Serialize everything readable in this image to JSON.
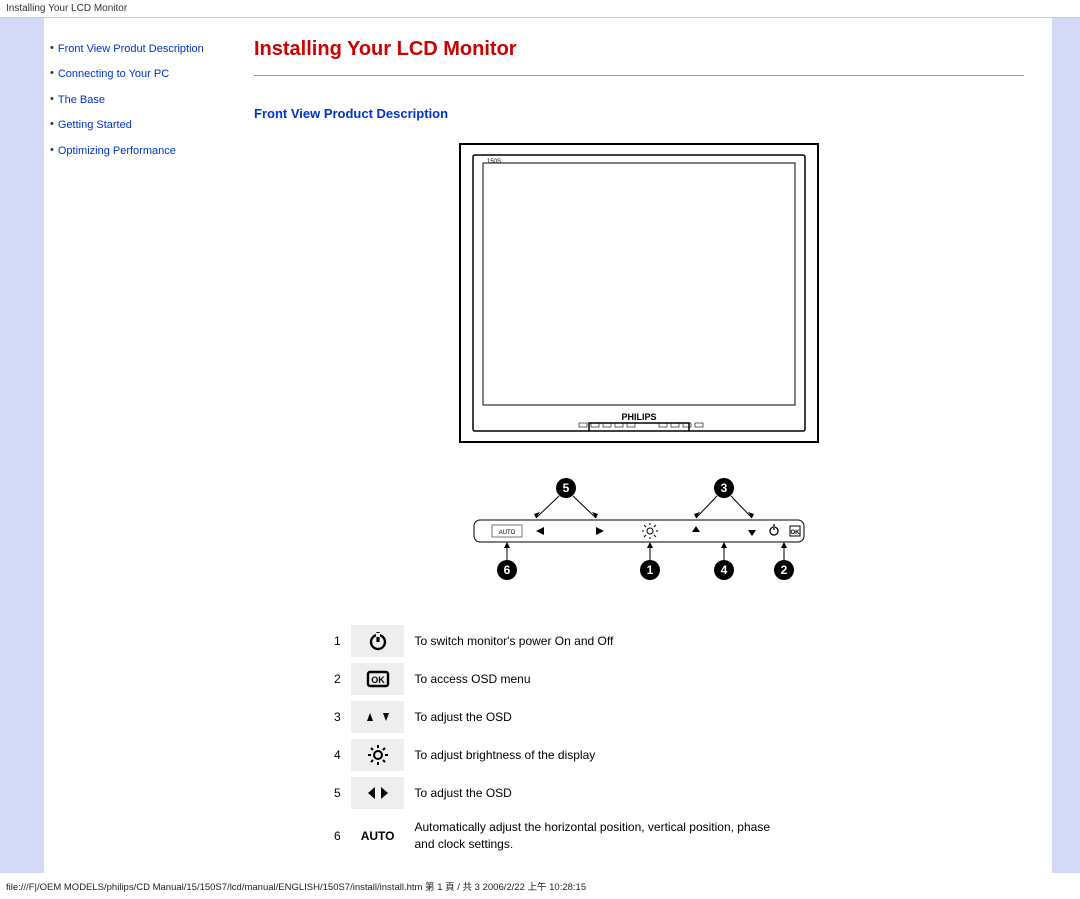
{
  "header": {
    "title": "Installing Your LCD Monitor"
  },
  "sidebar": {
    "items": [
      {
        "label": "Front View Produt Description"
      },
      {
        "label": "Connecting to Your PC"
      },
      {
        "label": "The Base"
      },
      {
        "label": "Getting Started"
      },
      {
        "label": "Optimizing Performance"
      }
    ]
  },
  "main": {
    "title": "Installing Your LCD Monitor",
    "section_title": "Front View Product Description",
    "monitor_brand": "PHILIPS",
    "panel_auto_label": "AUTO"
  },
  "legend": {
    "rows": [
      {
        "num": "1",
        "icon": "power",
        "desc": "To switch monitor's power On and Off"
      },
      {
        "num": "2",
        "icon": "ok",
        "desc": "To access OSD menu"
      },
      {
        "num": "3",
        "icon": "updown",
        "desc": "To adjust the OSD"
      },
      {
        "num": "4",
        "icon": "brightness",
        "desc": "To adjust brightness of the display"
      },
      {
        "num": "5",
        "icon": "leftright",
        "desc": "To adjust the OSD"
      },
      {
        "num": "6",
        "icon": "auto",
        "label": "AUTO",
        "desc": "Automatically adjust the horizontal position, vertical position, phase and clock settings."
      }
    ]
  },
  "footer": {
    "path": "file:///F|/OEM MODELS/philips/CD Manual/15/150S7/lcd/manual/ENGLISH/150S7/install/install.htm 第 1 頁 / 共 3 2006/2/22 上午 10:28:15"
  }
}
